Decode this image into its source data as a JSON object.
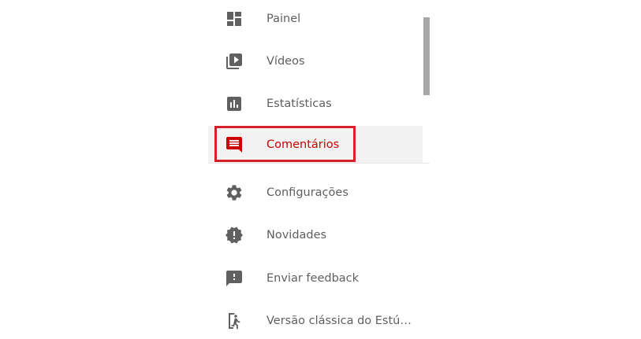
{
  "colors": {
    "text": "#5f5f5f",
    "icon": "#606060",
    "active": "#cc0000",
    "active_background": "#f2f2f2",
    "highlight_border": "#d6212b",
    "scrollbar": "#a8a8a8"
  },
  "sidebar": {
    "items": [
      {
        "label": "Painel",
        "icon": "dashboard-icon",
        "active": false
      },
      {
        "label": "Vídeos",
        "icon": "video-library-icon",
        "active": false
      },
      {
        "label": "Estatísticas",
        "icon": "analytics-icon",
        "active": false
      },
      {
        "label": "Comentários",
        "icon": "comment-icon",
        "active": true
      },
      {
        "label": "Configurações",
        "icon": "gear-icon",
        "active": false
      },
      {
        "label": "Novidades",
        "icon": "new-badge-icon",
        "active": false
      },
      {
        "label": "Enviar feedback",
        "icon": "feedback-icon",
        "active": false
      },
      {
        "label": "Versão clássica do Estúd...",
        "icon": "exit-classic-icon",
        "active": false
      }
    ]
  }
}
